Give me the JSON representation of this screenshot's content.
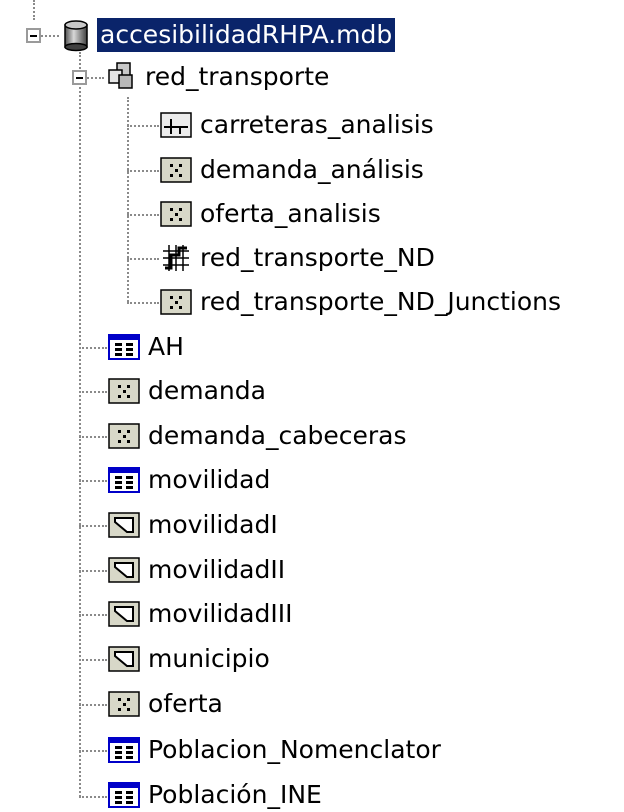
{
  "tree": {
    "root": {
      "label": "accesibilidadRHPA.mdb",
      "icon": "database-cylinder-icon",
      "selected": true
    },
    "dataset": {
      "label": "red_transporte",
      "icon": "feature-dataset-icon"
    },
    "dataset_children": [
      {
        "label": "carreteras_analisis",
        "icon": "line-feature-class-icon"
      },
      {
        "label": "demanda_análisis",
        "icon": "point-feature-class-icon"
      },
      {
        "label": "oferta_analisis",
        "icon": "point-feature-class-icon"
      },
      {
        "label": "red_transporte_ND",
        "icon": "network-dataset-icon"
      },
      {
        "label": "red_transporte_ND_Junctions",
        "icon": "point-feature-class-icon"
      }
    ],
    "items": [
      {
        "label": "AH",
        "icon": "table-icon"
      },
      {
        "label": "demanda",
        "icon": "point-feature-class-icon"
      },
      {
        "label": "demanda_cabeceras",
        "icon": "point-feature-class-icon"
      },
      {
        "label": "movilidad",
        "icon": "table-icon"
      },
      {
        "label": "movilidadI",
        "icon": "polygon-feature-class-icon"
      },
      {
        "label": "movilidadII",
        "icon": "polygon-feature-class-icon"
      },
      {
        "label": "movilidadIII",
        "icon": "polygon-feature-class-icon"
      },
      {
        "label": "municipio",
        "icon": "polygon-feature-class-icon"
      },
      {
        "label": "oferta",
        "icon": "point-feature-class-icon"
      },
      {
        "label": "Poblacion_Nomenclator",
        "icon": "table-icon"
      },
      {
        "label": "Población_INE",
        "icon": "table-icon"
      }
    ]
  }
}
